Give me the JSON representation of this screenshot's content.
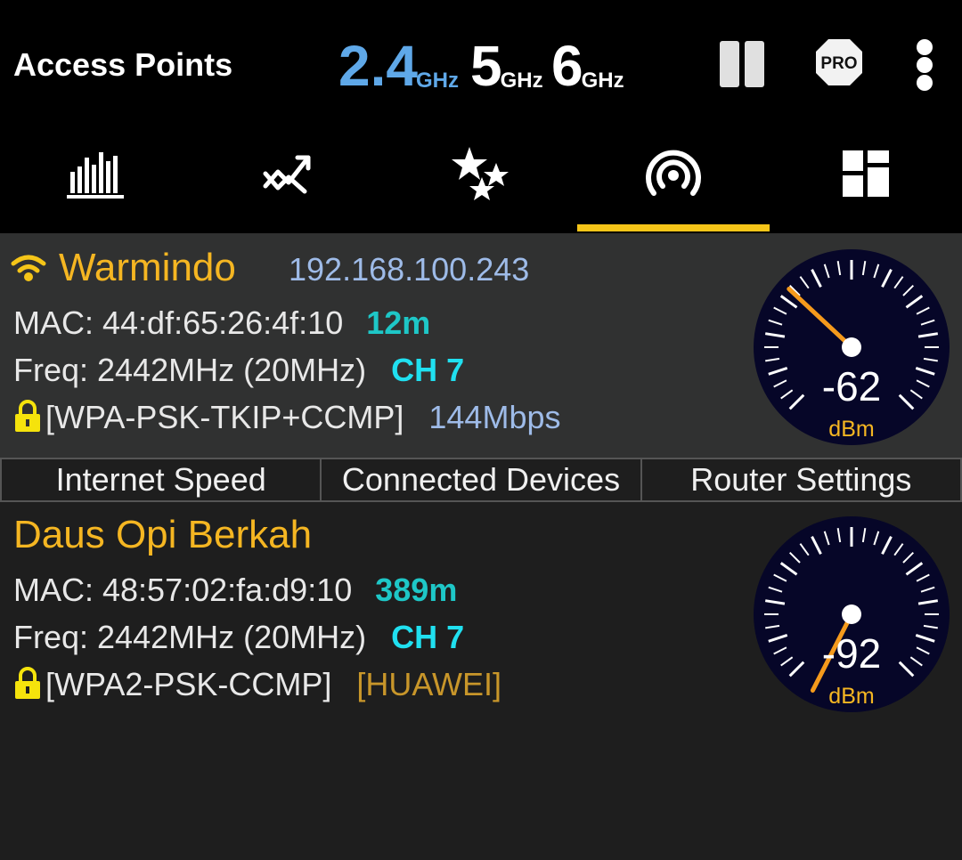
{
  "header": {
    "title": "Access Points",
    "bands": [
      {
        "value": "2.4",
        "unit": "GHz",
        "active": true
      },
      {
        "value": "5",
        "unit": "GHz",
        "active": false
      },
      {
        "value": "6",
        "unit": "GHz",
        "active": false
      }
    ],
    "pro_badge": "PRO"
  },
  "tabs": [
    {
      "icon": "bar-chart-icon"
    },
    {
      "icon": "trend-graph-icon"
    },
    {
      "icon": "stars-icon"
    },
    {
      "icon": "access-point-icon",
      "active": true
    },
    {
      "icon": "dashboard-icon"
    }
  ],
  "access_points": [
    {
      "ssid": "Warmindo",
      "ip": "192.168.100.243",
      "mac_line": "MAC: 44:df:65:26:4f:10",
      "distance": "12m",
      "freq_line": "Freq: 2442MHz  (20MHz)",
      "channel": "CH 7",
      "security": "[WPA-PSK-TKIP+CCMP]",
      "extra": "144Mbps",
      "signal": "-62",
      "signal_unit": "dBm",
      "signal_dbm": -62
    },
    {
      "ssid": "Daus Opi Berkah",
      "mac_line": "MAC: 48:57:02:fa:d9:10",
      "distance": "389m",
      "freq_line": "Freq: 2442MHz  (20MHz)",
      "channel": "CH 7",
      "security": "[WPA2-PSK-CCMP]",
      "extra": "[HUAWEI]",
      "signal": "-92",
      "signal_unit": "dBm",
      "signal_dbm": -92
    }
  ],
  "actions": [
    "Internet Speed",
    "Connected Devices",
    "Router Settings"
  ],
  "colors": {
    "accent": "#f5c518",
    "ssid": "#f5b622",
    "band_active": "#5fa8e8",
    "channel": "#20e0f0",
    "needle": "#f59a1c"
  }
}
